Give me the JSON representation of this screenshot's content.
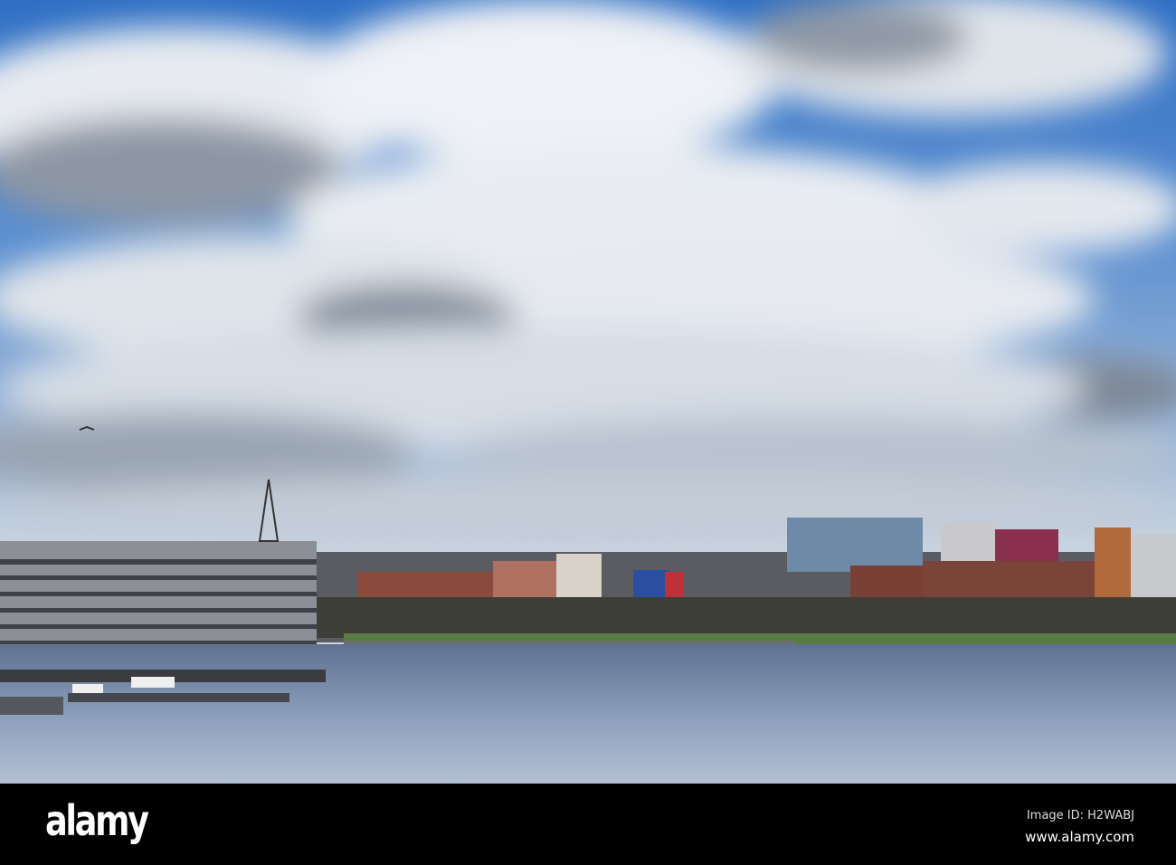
{
  "watermark": {
    "logo": "alamy",
    "image_id": "Image ID: H2WABJ",
    "site": "www.alamy.com"
  },
  "colors": {
    "sky": "#2f6fc4",
    "cloud": "#e9edf2",
    "water": "#7f93ad",
    "banner": "#000000"
  }
}
